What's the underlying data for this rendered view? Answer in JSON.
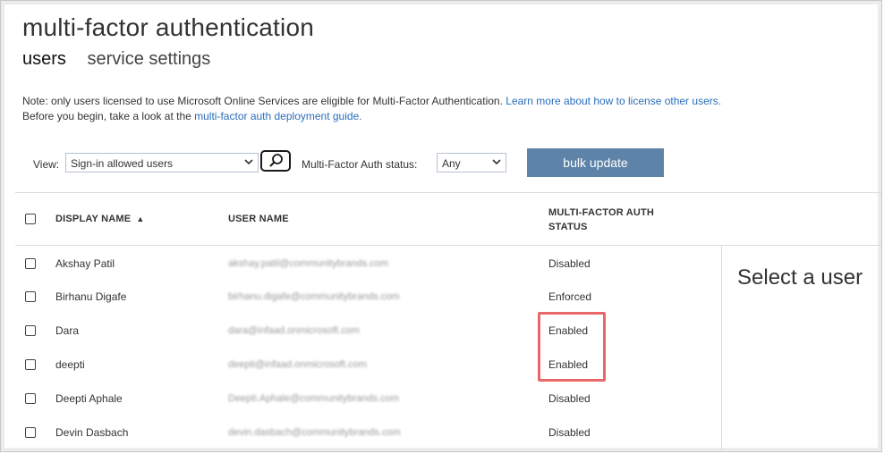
{
  "page": {
    "title": "multi-factor authentication",
    "tabs": [
      {
        "label": "users",
        "active": true
      },
      {
        "label": "service settings",
        "active": false
      }
    ]
  },
  "note": {
    "line1_text": "Note: only users licensed to use Microsoft Online Services are eligible for Multi-Factor Authentication.",
    "line1_link": "Learn more about how to license other users.",
    "line2_text": "Before you begin, take a look at the",
    "line2_link": "multi-factor auth deployment guide."
  },
  "toolbar": {
    "view_label": "View:",
    "view_value": "Sign-in allowed users",
    "status_label": "Multi-Factor Auth status:",
    "status_value": "Any",
    "bulk_update_label": "bulk update"
  },
  "table": {
    "columns": {
      "display_name": "DISPLAY NAME",
      "sort_indicator": "▲",
      "user_name": "USER NAME",
      "mfa_status_line1": "MULTI-FACTOR AUTH",
      "mfa_status_line2": "STATUS"
    },
    "rows": [
      {
        "display_name": "Akshay Patil",
        "user_name": "akshay.patil@communitybrands.com",
        "status": "Disabled"
      },
      {
        "display_name": "Birhanu Digafe",
        "user_name": "birhanu.digafe@communitybrands.com",
        "status": "Enforced"
      },
      {
        "display_name": "Dara",
        "user_name": "dara@infaad.onmicrosoft.com",
        "status": "Enabled"
      },
      {
        "display_name": "deepti",
        "user_name": "deepti@infaad.onmicrosoft.com",
        "status": "Enabled"
      },
      {
        "display_name": "Deepti Aphale",
        "user_name": "Deepti.Aphale@communitybrands.com",
        "status": "Disabled"
      },
      {
        "display_name": "Devin Dasbach",
        "user_name": "devin.dasbach@communitybrands.com",
        "status": "Disabled"
      }
    ]
  },
  "detail": {
    "placeholder": "Select a user"
  },
  "colors": {
    "accent_link": "#2a6ebb",
    "button_bg": "#5d84a8",
    "highlight": "#e8686a"
  }
}
